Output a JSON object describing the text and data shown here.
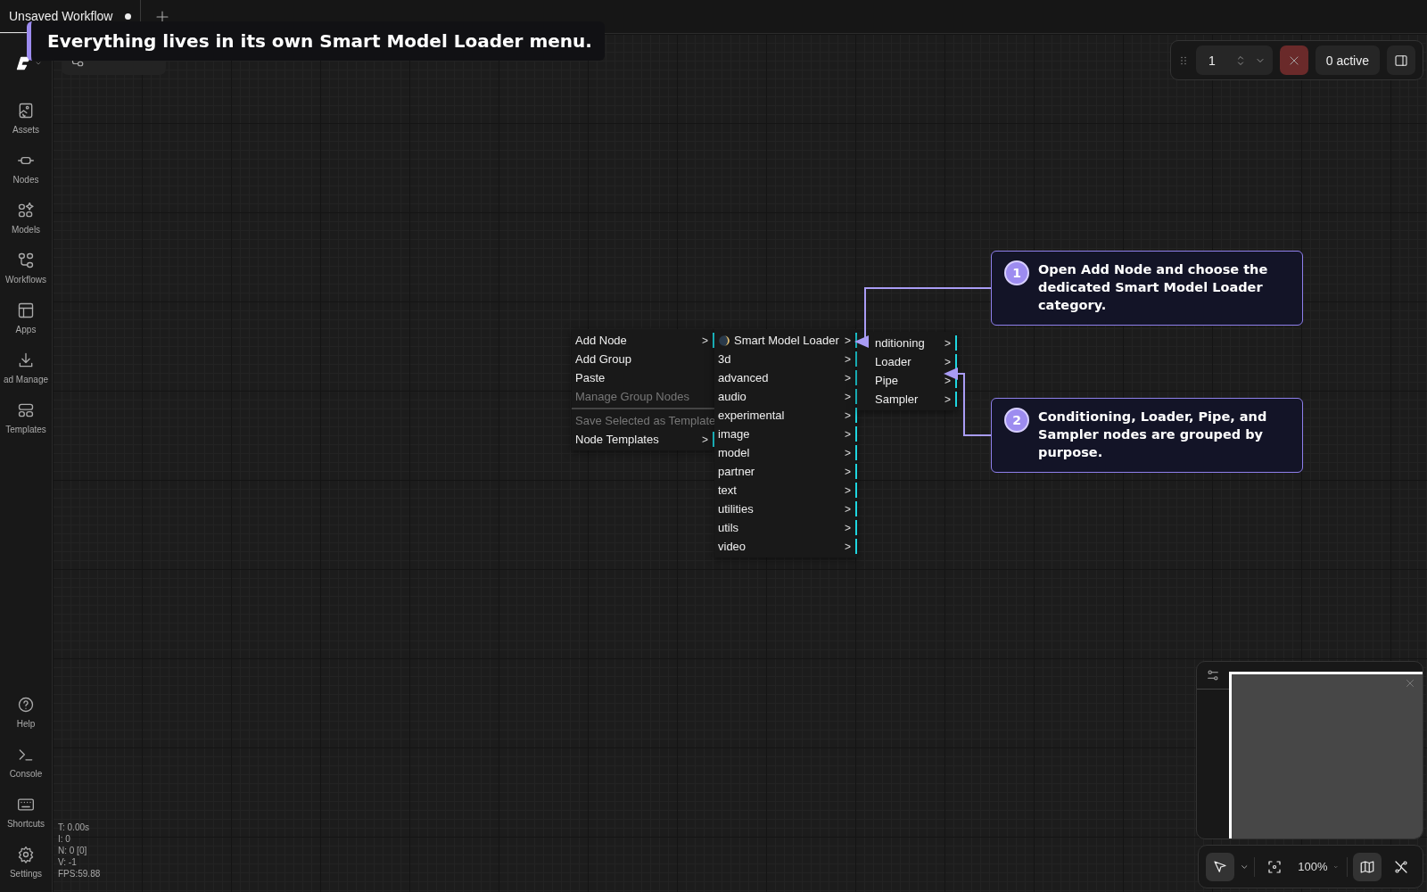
{
  "tabs": [
    {
      "title": "Unsaved Workflow",
      "modified": true,
      "selected": true
    }
  ],
  "tutorial_banner": {
    "text": "Everything lives in its own Smart Model Loader menu."
  },
  "graph_button": {
    "kind": "graph"
  },
  "sidebar": {
    "items": [
      {
        "label": "Assets",
        "kind": "assets"
      },
      {
        "label": "Nodes",
        "kind": "nodes"
      },
      {
        "label": "Models",
        "kind": "models"
      },
      {
        "label": "Workflows",
        "kind": "workflows"
      },
      {
        "label": "Apps",
        "kind": "apps"
      },
      {
        "label": "ad Manage",
        "kind": "download"
      },
      {
        "label": "Templates",
        "kind": "templates"
      }
    ],
    "bottom_items": [
      {
        "label": "Help",
        "kind": "help"
      },
      {
        "label": "Console",
        "kind": "console"
      },
      {
        "label": "Shortcuts",
        "kind": "shortcuts"
      },
      {
        "label": "Settings",
        "kind": "settings"
      }
    ]
  },
  "stats": [
    "T: 0.00s",
    "I: 0",
    "N: 0 [0]",
    "V: -1",
    "FPS:59.88"
  ],
  "queue_toolbar": {
    "batch_count": "1",
    "active_label": "0 active"
  },
  "context_menu": {
    "items": [
      {
        "label": "Add Node",
        "arrow": ">",
        "disabled": false,
        "separator_before": false
      },
      {
        "label": "Add Group",
        "disabled": false,
        "separator_before": false
      },
      {
        "label": "Paste",
        "disabled": false,
        "separator_before": false
      },
      {
        "label": "Manage Group Nodes",
        "disabled": true,
        "separator_before": false
      },
      {
        "label": "Save Selected as Template",
        "disabled": true,
        "separator_before": true
      },
      {
        "label": "Node Templates",
        "arrow": ">",
        "disabled": false,
        "separator_before": false
      }
    ]
  },
  "submenu": {
    "items": [
      {
        "label": "Smart Model Loader",
        "arrow": ">",
        "kind": "moon"
      },
      {
        "label": "3d",
        "arrow": ">",
        "kind": "plain"
      },
      {
        "label": "advanced",
        "arrow": ">",
        "kind": "plain"
      },
      {
        "label": "audio",
        "arrow": ">",
        "kind": "plain"
      },
      {
        "label": "experimental",
        "arrow": ">",
        "kind": "plain"
      },
      {
        "label": "image",
        "arrow": ">",
        "kind": "plain"
      },
      {
        "label": "model",
        "arrow": ">",
        "kind": "plain"
      },
      {
        "label": "partner",
        "arrow": ">",
        "kind": "plain"
      },
      {
        "label": "text",
        "arrow": ">",
        "kind": "plain"
      },
      {
        "label": "utilities",
        "arrow": ">",
        "kind": "plain"
      },
      {
        "label": "utils",
        "arrow": ">",
        "kind": "plain"
      },
      {
        "label": "video",
        "arrow": ">",
        "kind": "plain"
      }
    ]
  },
  "submenu_2": {
    "items": [
      {
        "label": "nditioning",
        "arrow": ">"
      },
      {
        "label": "Loader",
        "arrow": ">"
      },
      {
        "label": "Pipe",
        "arrow": ">"
      },
      {
        "label": "Sampler",
        "arrow": ">"
      }
    ]
  },
  "callouts": [
    {
      "number": "1",
      "text": "Open Add Node and choose the dedicated Smart Model Loader category."
    },
    {
      "number": "2",
      "text": "Conditioning, Loader, Pipe, and Sampler nodes are grouped by purpose."
    }
  ],
  "zoom_toolbar": {
    "select_selected": true,
    "zoom": "100%",
    "minimap_selected": true
  }
}
